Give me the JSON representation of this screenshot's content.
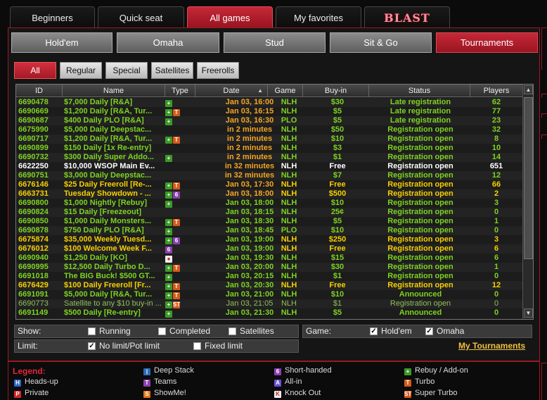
{
  "top_tabs": [
    {
      "label": "Beginners",
      "active": false
    },
    {
      "label": "Quick seat",
      "active": false
    },
    {
      "label": "All games",
      "active": true
    },
    {
      "label": "My favorites",
      "active": false
    },
    {
      "label": "BLAST",
      "active": false
    }
  ],
  "game_buttons": [
    {
      "label": "Hold'em",
      "active": false
    },
    {
      "label": "Omaha",
      "active": false
    },
    {
      "label": "Stud",
      "active": false
    },
    {
      "label": "Sit & Go",
      "active": false
    },
    {
      "label": "Tournaments",
      "active": true
    }
  ],
  "filter_buttons": [
    {
      "label": "All",
      "active": true
    },
    {
      "label": "Regular",
      "active": false
    },
    {
      "label": "Special",
      "active": false
    },
    {
      "label": "Satellites",
      "active": false
    },
    {
      "label": "Freerolls",
      "active": false
    }
  ],
  "table": {
    "columns": [
      "ID",
      "Name",
      "Type",
      "Date",
      "Game",
      "Buy-in",
      "Status",
      "Players"
    ],
    "sort_indicator": "▲",
    "rows": [
      {
        "id": "6690478",
        "name": "$7,000 Daily [R&A]",
        "type": [
          "plus"
        ],
        "date": "Jan 03, 16:00",
        "game": "NLH",
        "buyin": "$30",
        "status": "Late registration",
        "players": "62",
        "color": "#7ed321",
        "dcolor": "#f5a623"
      },
      {
        "id": "6690669",
        "name": "$1,200 Daily [R&A, Tur...",
        "type": [
          "plus",
          "turbo"
        ],
        "date": "Jan 03, 16:15",
        "game": "NLH",
        "buyin": "$5",
        "status": "Late registration",
        "players": "77",
        "color": "#7ed321",
        "dcolor": "#f5a623"
      },
      {
        "id": "6690687",
        "name": "$400 Daily PLO [R&A]",
        "type": [
          "plus"
        ],
        "date": "Jan 03, 16:30",
        "game": "PLO",
        "buyin": "$5",
        "status": "Late registration",
        "players": "23",
        "color": "#7ed321",
        "dcolor": "#f5a623"
      },
      {
        "id": "6675990",
        "name": "$5,000 Daily Deepstac...",
        "type": [],
        "date": "in 2 minutes",
        "game": "NLH",
        "buyin": "$50",
        "status": "Registration open",
        "players": "32",
        "color": "#7ed321",
        "dcolor": "#f5a623"
      },
      {
        "id": "6690717",
        "name": "$1,200 Daily [R&A, Tur...",
        "type": [
          "plus",
          "turbo"
        ],
        "date": "in 2 minutes",
        "game": "NLH",
        "buyin": "$10",
        "status": "Registration open",
        "players": "8",
        "color": "#7ed321",
        "dcolor": "#f5a623"
      },
      {
        "id": "6690899",
        "name": "$150 Daily [1x Re-entry]",
        "type": [],
        "date": "in 2 minutes",
        "game": "NLH",
        "buyin": "$3",
        "status": "Registration open",
        "players": "10",
        "color": "#7ed321",
        "dcolor": "#f5a623"
      },
      {
        "id": "6690732",
        "name": "$300 Daily Super Addo...",
        "type": [
          "plus"
        ],
        "date": "in 2 minutes",
        "game": "NLH",
        "buyin": "$1",
        "status": "Registration open",
        "players": "14",
        "color": "#7ed321",
        "dcolor": "#f5a623"
      },
      {
        "id": "6622250",
        "name": "$10,000 WSOP Main Ev...",
        "type": [],
        "date": "in 32 minutes",
        "game": "NLH",
        "buyin": "Free",
        "status": "Registration open",
        "players": "651",
        "color": "#ffffff",
        "dcolor": "#f5a623"
      },
      {
        "id": "6690751",
        "name": "$3,000 Daily Deepstac...",
        "type": [],
        "date": "in 32 minutes",
        "game": "NLH",
        "buyin": "$7",
        "status": "Registration open",
        "players": "12",
        "color": "#7ed321",
        "dcolor": "#f5a623"
      },
      {
        "id": "6676146",
        "name": "$25 Daily Freeroll [Re-...",
        "type": [
          "plus",
          "turbo"
        ],
        "date": "Jan 03, 17:30",
        "game": "NLH",
        "buyin": "Free",
        "status": "Registration open",
        "players": "66",
        "color": "#f5d000",
        "dcolor": "#f5a623"
      },
      {
        "id": "6663731",
        "name": "Tuesday Showdown - ...",
        "type": [
          "plus",
          "six"
        ],
        "date": "Jan 03, 18:00",
        "game": "NLH",
        "buyin": "$500",
        "status": "Registration open",
        "players": "2",
        "color": "#f5d000",
        "dcolor": "#f5a623"
      },
      {
        "id": "6690800",
        "name": "$1,000 Nightly [Rebuy]",
        "type": [
          "plus"
        ],
        "date": "Jan 03, 18:00",
        "game": "NLH",
        "buyin": "$10",
        "status": "Registration open",
        "players": "3",
        "color": "#7ed321",
        "dcolor": "#7ed321"
      },
      {
        "id": "6690824",
        "name": "$15 Daily [Freezeout]",
        "type": [],
        "date": "Jan 03, 18:15",
        "game": "NLH",
        "buyin": "25¢",
        "status": "Registration open",
        "players": "0",
        "color": "#7ed321",
        "dcolor": "#7ed321"
      },
      {
        "id": "6690850",
        "name": "$1,000 Daily Monsters...",
        "type": [
          "plus",
          "turbo"
        ],
        "date": "Jan 03, 18:30",
        "game": "NLH",
        "buyin": "$5",
        "status": "Registration open",
        "players": "1",
        "color": "#7ed321",
        "dcolor": "#7ed321"
      },
      {
        "id": "6690878",
        "name": "$750 Daily PLO [R&A]",
        "type": [
          "plus"
        ],
        "date": "Jan 03, 18:45",
        "game": "PLO",
        "buyin": "$10",
        "status": "Registration open",
        "players": "0",
        "color": "#7ed321",
        "dcolor": "#7ed321"
      },
      {
        "id": "6675874",
        "name": "$35,000 Weekly Tuesd...",
        "type": [
          "plus",
          "six"
        ],
        "date": "Jan 03, 19:00",
        "game": "NLH",
        "buyin": "$250",
        "status": "Registration open",
        "players": "3",
        "color": "#f5d000",
        "dcolor": "#7ed321"
      },
      {
        "id": "6676012",
        "name": "$100 Welcome Week F...",
        "type": [
          "six"
        ],
        "date": "Jan 03, 19:00",
        "game": "NLH",
        "buyin": "Free",
        "status": "Registration open",
        "players": "6",
        "color": "#f5d000",
        "dcolor": "#7ed321"
      },
      {
        "id": "6690940",
        "name": "$1,250 Daily [KO]",
        "type": [
          "ko"
        ],
        "date": "Jan 03, 19:30",
        "game": "NLH",
        "buyin": "$15",
        "status": "Registration open",
        "players": "6",
        "color": "#7ed321",
        "dcolor": "#7ed321"
      },
      {
        "id": "6690995",
        "name": "$12,500 Daily Turbo D...",
        "type": [
          "plus",
          "turbo"
        ],
        "date": "Jan 03, 20:00",
        "game": "NLH",
        "buyin": "$30",
        "status": "Registration open",
        "players": "1",
        "color": "#7ed321",
        "dcolor": "#7ed321"
      },
      {
        "id": "6691018",
        "name": "The BIG Buck! $500 GT...",
        "type": [
          "plus"
        ],
        "date": "Jan 03, 20:15",
        "game": "NLH",
        "buyin": "$1",
        "status": "Registration open",
        "players": "0",
        "color": "#7ed321",
        "dcolor": "#7ed321"
      },
      {
        "id": "6676429",
        "name": "$100 Daily Freeroll [Fr...",
        "type": [
          "plus",
          "turbo"
        ],
        "date": "Jan 03, 20:30",
        "game": "NLH",
        "buyin": "Free",
        "status": "Registration open",
        "players": "12",
        "color": "#f5d000",
        "dcolor": "#7ed321"
      },
      {
        "id": "6691091",
        "name": "$5,000 Daily [R&A, Tur...",
        "type": [
          "plus",
          "turbo"
        ],
        "date": "Jan 03, 21:00",
        "game": "NLH",
        "buyin": "$10",
        "status": "Announced",
        "players": "0",
        "color": "#7ed321",
        "dcolor": "#7ed321"
      },
      {
        "id": "6690773",
        "name": "Satellite to any $10 buy-in ...",
        "type": [
          "plus",
          "st"
        ],
        "date": "Jan 03, 21:05",
        "game": "NLH",
        "buyin": "$1",
        "status": "Registration open",
        "players": "0",
        "color": "#8fbf5a",
        "dcolor": "#8fbf5a",
        "normal": true
      },
      {
        "id": "6691149",
        "name": "$500 Daily [Re-entry]",
        "type": [
          "plus"
        ],
        "date": "Jan 03, 21:30",
        "game": "NLH",
        "buyin": "$5",
        "status": "Announced",
        "players": "0",
        "color": "#7ed321",
        "dcolor": "#7ed321"
      }
    ]
  },
  "show": {
    "label": "Show:",
    "options": [
      {
        "label": "Running",
        "checked": false
      },
      {
        "label": "Completed",
        "checked": false
      },
      {
        "label": "Satellites",
        "checked": false
      }
    ]
  },
  "game_filter": {
    "label": "Game:",
    "options": [
      {
        "label": "Hold'em",
        "checked": true
      },
      {
        "label": "Omaha",
        "checked": true
      }
    ]
  },
  "limit": {
    "label": "Limit:",
    "options": [
      {
        "label": "No limit/Pot limit",
        "checked": true
      },
      {
        "label": "Fixed limit",
        "checked": false
      }
    ]
  },
  "my_tournaments": "My Tournaments",
  "legend": {
    "title": "Legend:",
    "items": [
      {
        "icon": "ph",
        "glyph": "H",
        "label": "Heads-up"
      },
      {
        "icon": "pr",
        "glyph": "P",
        "label": "Private"
      },
      {
        "icon": "di",
        "glyph": "|",
        "label": "Deep Stack"
      },
      {
        "icon": "tm",
        "glyph": "T",
        "label": "Teams"
      },
      {
        "icon": "sm",
        "glyph": "S",
        "label": "ShowMe!"
      },
      {
        "icon": "six",
        "glyph": "6",
        "label": "Short-handed"
      },
      {
        "icon": "ai",
        "glyph": "A",
        "label": "All-in"
      },
      {
        "icon": "ko",
        "glyph": "K",
        "label": "Knock Out"
      },
      {
        "icon": "plus",
        "glyph": "+",
        "label": "Rebuy / Add-on"
      },
      {
        "icon": "turbo",
        "glyph": "T",
        "label": "Turbo"
      },
      {
        "icon": "st",
        "glyph": "ST",
        "label": "Super Turbo"
      }
    ]
  },
  "colors": {
    "accent": "#c62838",
    "regular": "#7ed321",
    "special": "#f5d000",
    "date_soon": "#f5a623"
  }
}
